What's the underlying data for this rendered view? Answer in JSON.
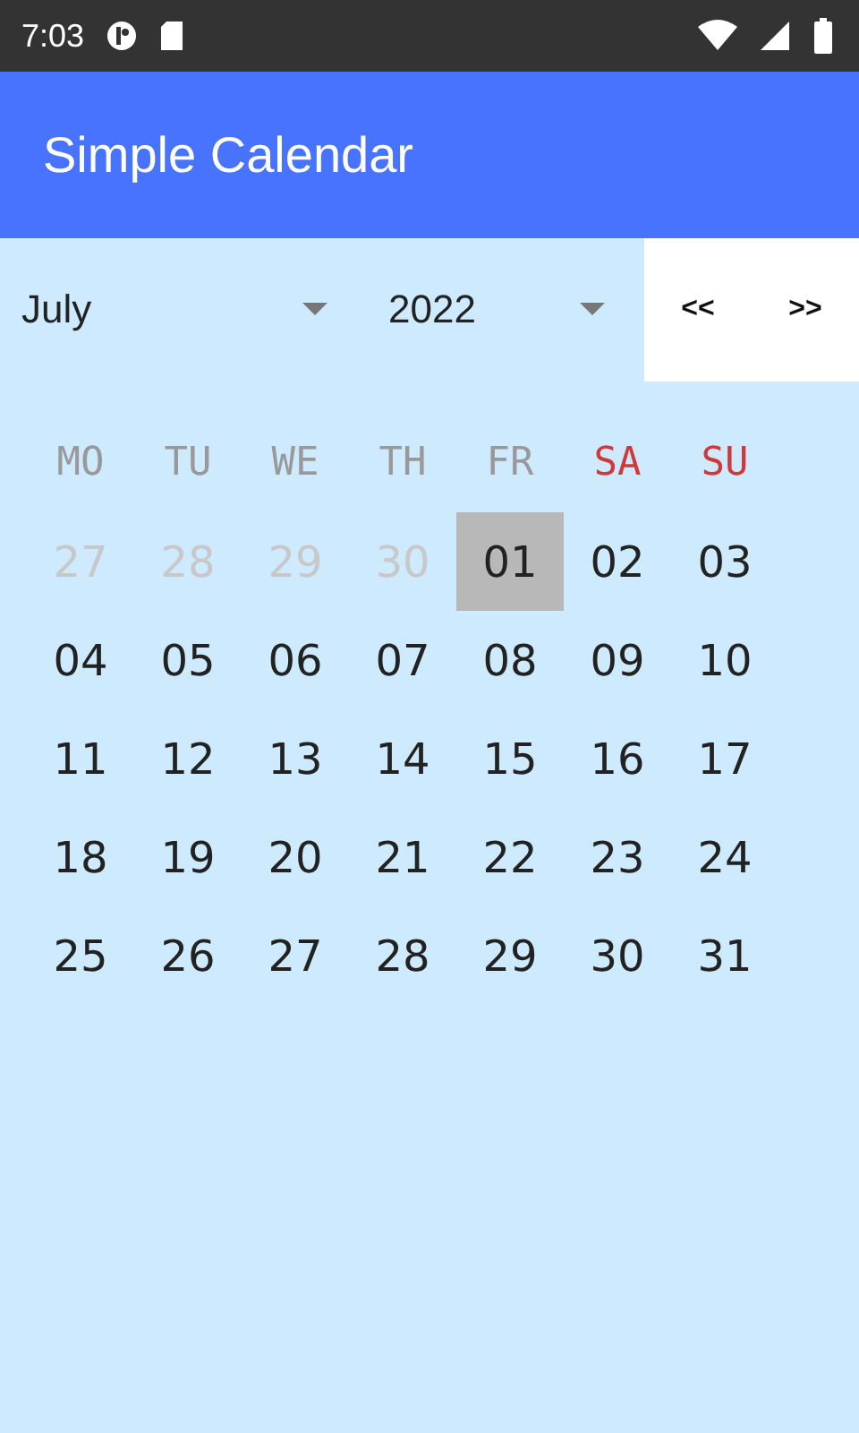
{
  "status_bar": {
    "time": "7:03"
  },
  "app_bar": {
    "title": "Simple Calendar"
  },
  "controls": {
    "month": "July",
    "year": "2022",
    "prev": "<<",
    "next": ">>"
  },
  "weekdays": [
    {
      "label": "MO",
      "weekend": false
    },
    {
      "label": "TU",
      "weekend": false
    },
    {
      "label": "WE",
      "weekend": false
    },
    {
      "label": "TH",
      "weekend": false
    },
    {
      "label": "FR",
      "weekend": false
    },
    {
      "label": "SA",
      "weekend": true
    },
    {
      "label": "SU",
      "weekend": true
    }
  ],
  "days": [
    {
      "label": "27",
      "outside": true,
      "selected": false
    },
    {
      "label": "28",
      "outside": true,
      "selected": false
    },
    {
      "label": "29",
      "outside": true,
      "selected": false
    },
    {
      "label": "30",
      "outside": true,
      "selected": false
    },
    {
      "label": "01",
      "outside": false,
      "selected": true
    },
    {
      "label": "02",
      "outside": false,
      "selected": false
    },
    {
      "label": "03",
      "outside": false,
      "selected": false
    },
    {
      "label": "04",
      "outside": false,
      "selected": false
    },
    {
      "label": "05",
      "outside": false,
      "selected": false
    },
    {
      "label": "06",
      "outside": false,
      "selected": false
    },
    {
      "label": "07",
      "outside": false,
      "selected": false
    },
    {
      "label": "08",
      "outside": false,
      "selected": false
    },
    {
      "label": "09",
      "outside": false,
      "selected": false
    },
    {
      "label": "10",
      "outside": false,
      "selected": false
    },
    {
      "label": "11",
      "outside": false,
      "selected": false
    },
    {
      "label": "12",
      "outside": false,
      "selected": false
    },
    {
      "label": "13",
      "outside": false,
      "selected": false
    },
    {
      "label": "14",
      "outside": false,
      "selected": false
    },
    {
      "label": "15",
      "outside": false,
      "selected": false
    },
    {
      "label": "16",
      "outside": false,
      "selected": false
    },
    {
      "label": "17",
      "outside": false,
      "selected": false
    },
    {
      "label": "18",
      "outside": false,
      "selected": false
    },
    {
      "label": "19",
      "outside": false,
      "selected": false
    },
    {
      "label": "20",
      "outside": false,
      "selected": false
    },
    {
      "label": "21",
      "outside": false,
      "selected": false
    },
    {
      "label": "22",
      "outside": false,
      "selected": false
    },
    {
      "label": "23",
      "outside": false,
      "selected": false
    },
    {
      "label": "24",
      "outside": false,
      "selected": false
    },
    {
      "label": "25",
      "outside": false,
      "selected": false
    },
    {
      "label": "26",
      "outside": false,
      "selected": false
    },
    {
      "label": "27",
      "outside": false,
      "selected": false
    },
    {
      "label": "28",
      "outside": false,
      "selected": false
    },
    {
      "label": "29",
      "outside": false,
      "selected": false
    },
    {
      "label": "30",
      "outside": false,
      "selected": false
    },
    {
      "label": "31",
      "outside": false,
      "selected": false
    }
  ]
}
